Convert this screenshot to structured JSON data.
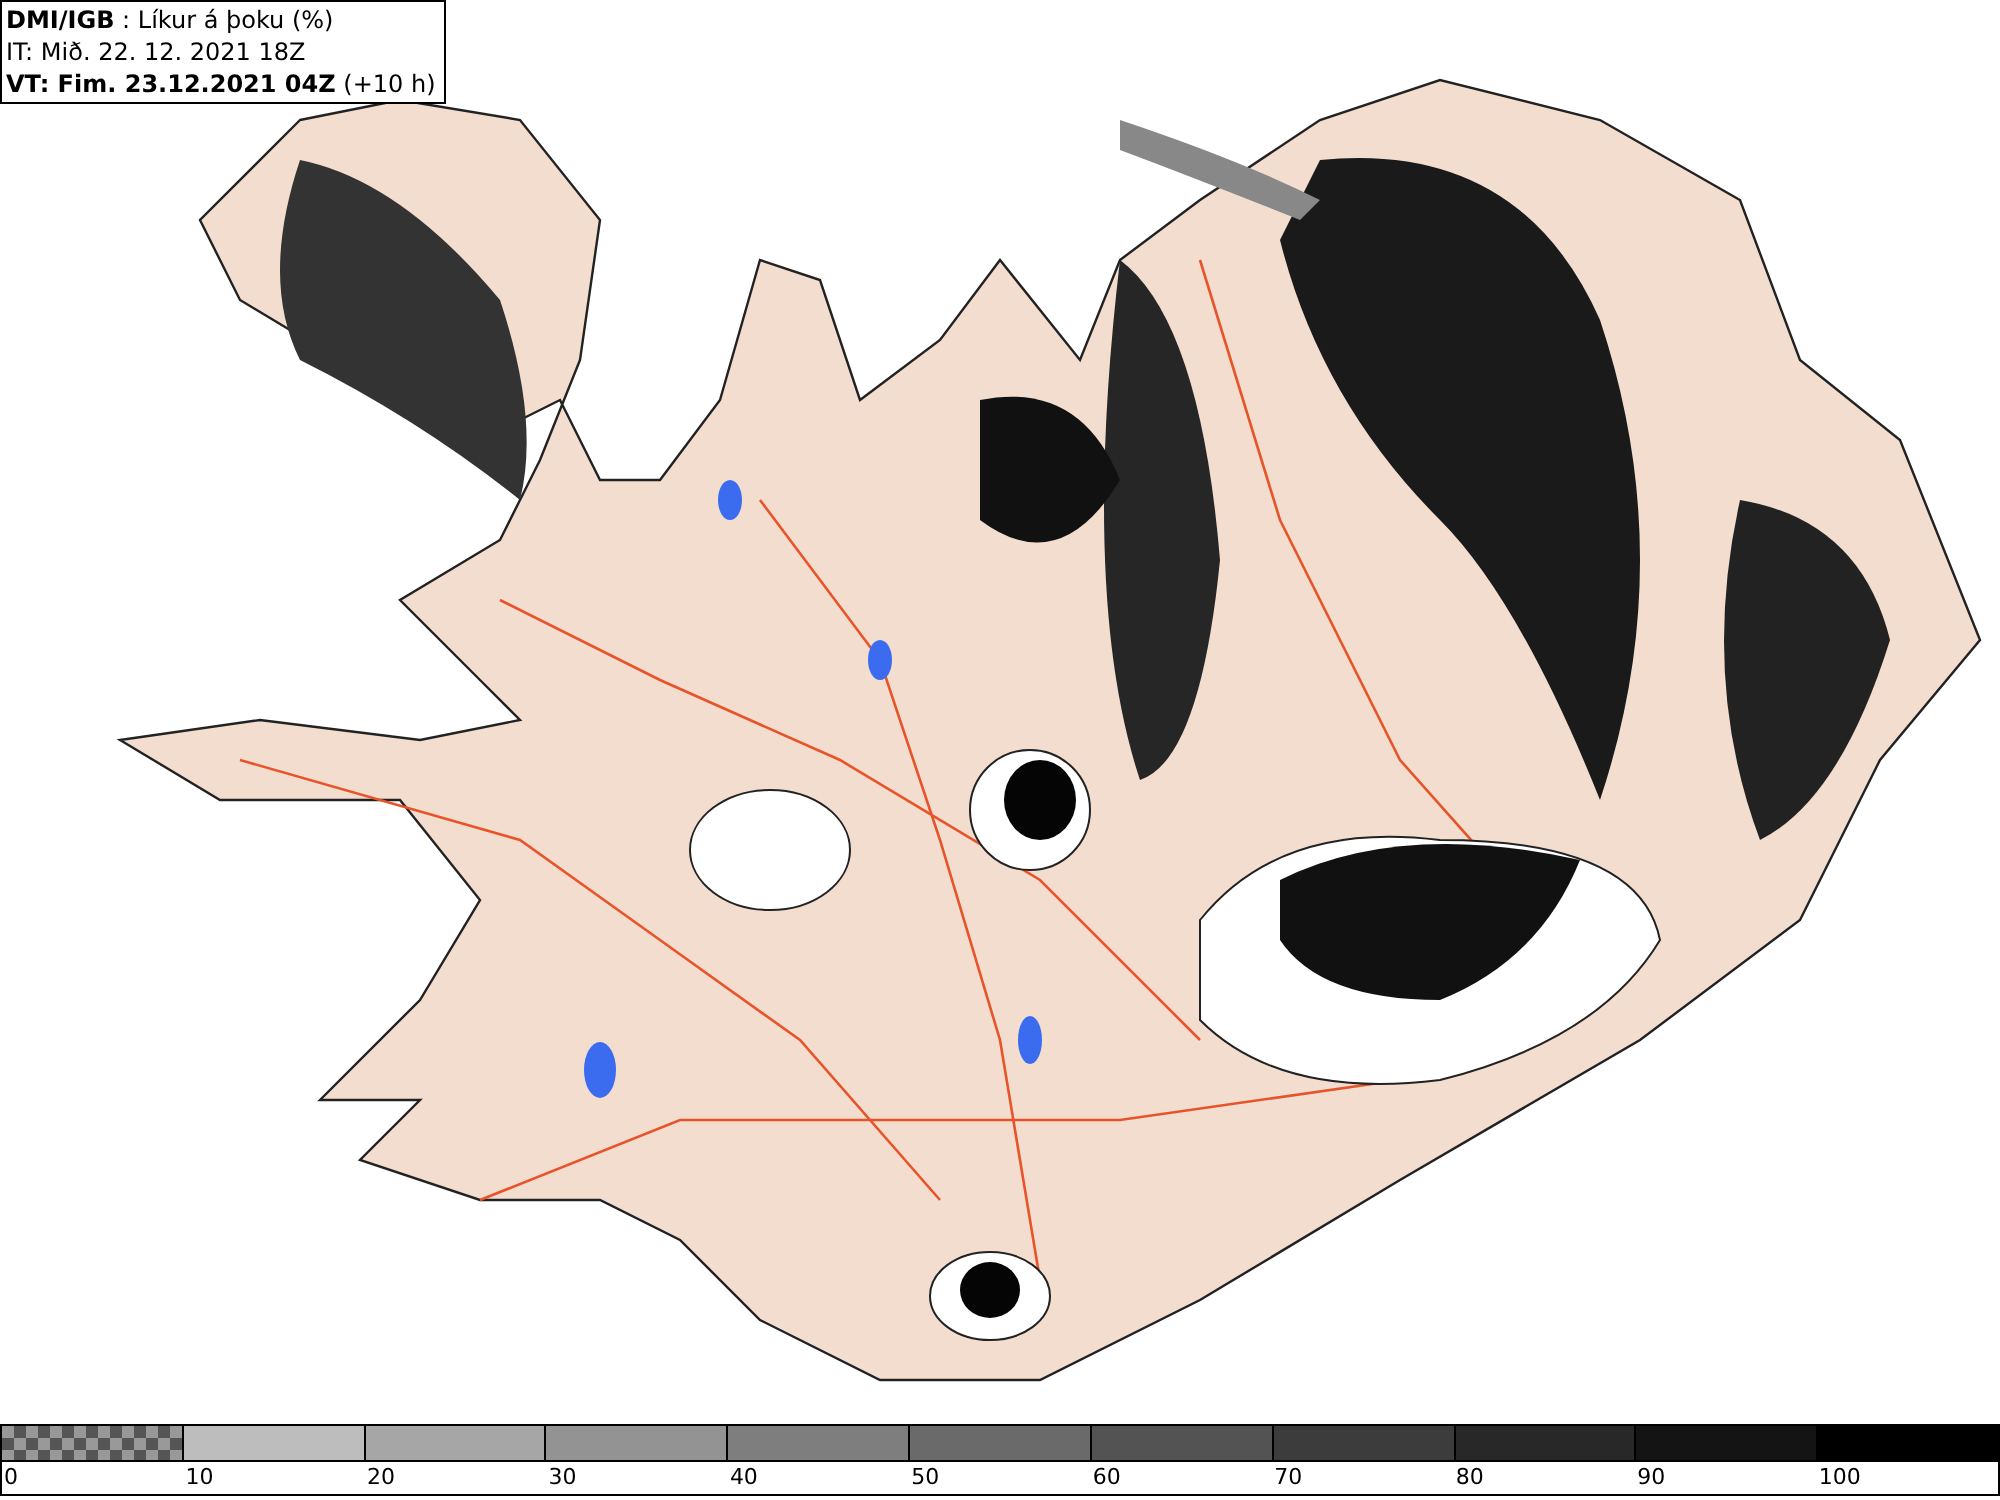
{
  "header": {
    "lines": [
      "**DMI/IGB** : Líkur á þoku (%)",
      "IT: Mið. 22. 12. 2021 18Z",
      "**VT: Fim. 23.12.2021 04Z** (+10 h)"
    ]
  },
  "legend": {
    "segments": [
      {
        "kind": "transparent"
      },
      {
        "kind": "solid",
        "color": "#bdbdbd"
      },
      {
        "kind": "solid",
        "color": "#a6a6a6"
      },
      {
        "kind": "solid",
        "color": "#939393"
      },
      {
        "kind": "solid",
        "color": "#7e7e7e"
      },
      {
        "kind": "solid",
        "color": "#6a6a6a"
      },
      {
        "kind": "solid",
        "color": "#535353"
      },
      {
        "kind": "solid",
        "color": "#3c3c3c"
      },
      {
        "kind": "solid",
        "color": "#282828"
      },
      {
        "kind": "solid",
        "color": "#141414"
      },
      {
        "kind": "solid",
        "color": "#000000"
      }
    ],
    "ticks": [
      "0",
      "10",
      "20",
      "30",
      "40",
      "50",
      "60",
      "70",
      "80",
      "90",
      "100"
    ]
  }
}
